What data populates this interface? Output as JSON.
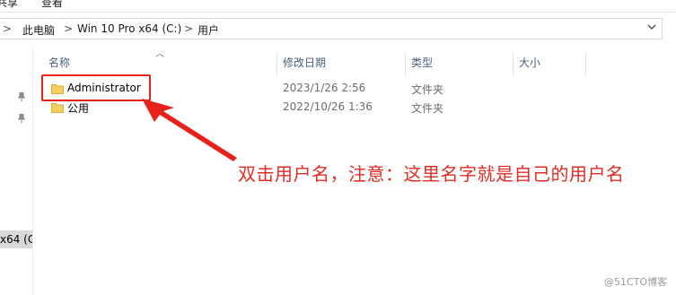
{
  "ribbon": {
    "items": [
      "共享",
      "查看"
    ]
  },
  "address_bar": {
    "segments": [
      "此电脑",
      "Win 10 Pro x64 (C:)",
      "用户"
    ],
    "separator": ">",
    "dropdown_icon": "chevron-down-icon"
  },
  "nav_pane": {
    "drive_label": "x64 (C:"
  },
  "columns": [
    "名称",
    "修改日期",
    "类型",
    "大小"
  ],
  "rows": [
    {
      "name": "Administrator",
      "date": "2023/1/26 2:56",
      "type": "文件夹"
    },
    {
      "name": "公用",
      "date": "2022/10/26 1:36",
      "type": "文件夹"
    }
  ],
  "annotation": {
    "text": "双击用户名，注意：这里名字就是自己的用户名",
    "color": "#e32b22"
  },
  "watermark": "@51CTO博客",
  "colors": {
    "folder": "#f7cf5e",
    "annotation_red": "#e8211b"
  }
}
